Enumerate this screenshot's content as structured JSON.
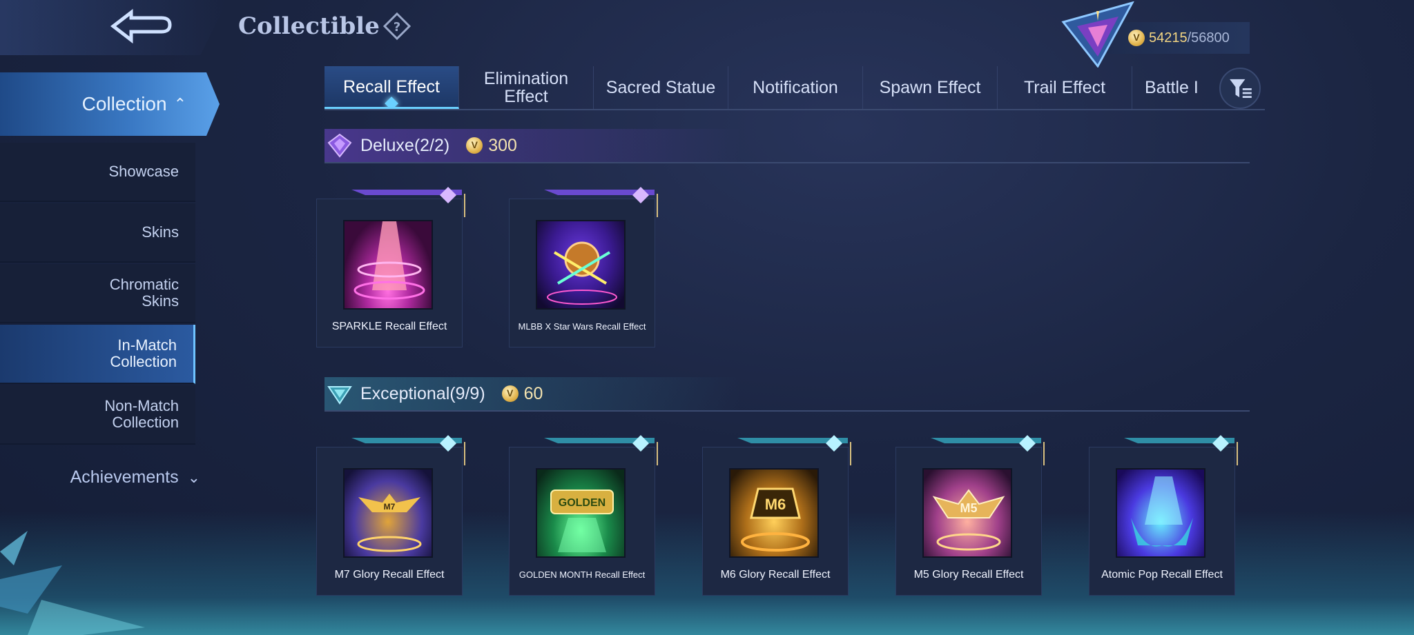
{
  "header": {
    "title": "Collectible",
    "currency_current": "54215",
    "currency_max": "/56800"
  },
  "sidebar": {
    "collection_label": "Collection",
    "items": [
      {
        "label": "Showcase"
      },
      {
        "label": "Skins"
      },
      {
        "label": "Chromatic Skins"
      },
      {
        "label": "In-Match Collection"
      },
      {
        "label": "Non-Match Collection"
      }
    ],
    "achievements_label": "Achievements"
  },
  "tabs": [
    {
      "label": "Recall Effect"
    },
    {
      "label": "Elimination Effect"
    },
    {
      "label": "Sacred Statue"
    },
    {
      "label": "Notification"
    },
    {
      "label": "Spawn Effect"
    },
    {
      "label": "Trail Effect"
    },
    {
      "label": "Battle I"
    }
  ],
  "sections": {
    "deluxe": {
      "label": "Deluxe(2/2)",
      "cost": "300",
      "items": [
        {
          "name": "SPARKLE Recall Effect"
        },
        {
          "name": "MLBB X Star Wars Recall Effect"
        }
      ]
    },
    "exceptional": {
      "label": "Exceptional(9/9)",
      "cost": "60",
      "items": [
        {
          "name": "M7 Glory Recall Effect"
        },
        {
          "name": "GOLDEN MONTH Recall Effect"
        },
        {
          "name": "M6 Glory Recall Effect"
        },
        {
          "name": "M5 Glory Recall Effect"
        },
        {
          "name": "Atomic Pop Recall Effect"
        }
      ]
    }
  },
  "colors": {
    "accent": "#6ad0ff",
    "gold": "#f3d583",
    "deluxe": "#8a5ae0",
    "exceptional": "#4fb6c8"
  }
}
